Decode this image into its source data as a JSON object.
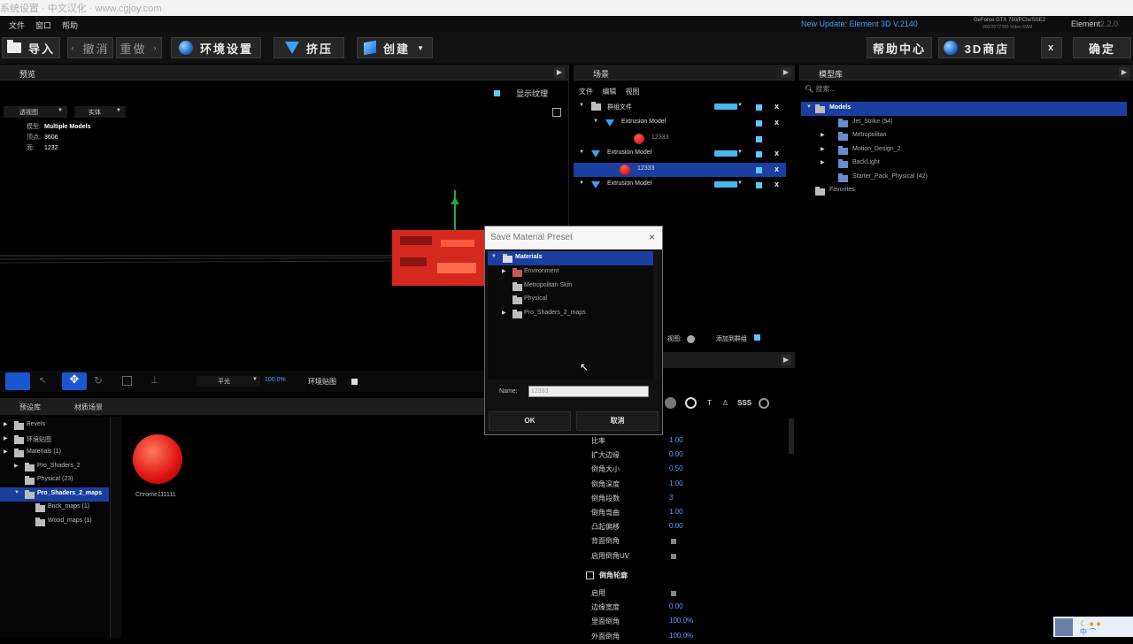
{
  "title_bar": {
    "text": "系统设置 · 中文汉化 · www.cgjoy.com"
  },
  "menu": {
    "items": [
      "文件",
      "窗口",
      "帮助"
    ],
    "update": "New Update: Element 3D V.2140",
    "gpu": "GeForce GTX 750/PCIe/SSE2",
    "gpu2": "900/3072 MB Video RAM",
    "app": "Element",
    "ver": "2.2.0"
  },
  "toolbar": {
    "import": "导入",
    "undo": "撤消",
    "redo": "重做",
    "env": "环境设置",
    "extrude": "挤压",
    "create": "创建",
    "help": "帮助中心",
    "store": "3D商店",
    "close": "x",
    "ok": "确定"
  },
  "viewport": {
    "title": "预览",
    "flat_texture": "显示纹理",
    "camera": "透视图",
    "mode": "实体",
    "info": [
      {
        "k": "模型:",
        "v": "Multiple Models"
      },
      {
        "k": "顶点:",
        "v": "3606"
      },
      {
        "k": "面:",
        "v": "1232"
      }
    ],
    "zoom_label": "平光",
    "zoom_value": "100.0%",
    "env_label": "环境贴图"
  },
  "scene": {
    "title": "场景",
    "menu": [
      "文件",
      "编辑",
      "视图"
    ],
    "rows": [
      {
        "label": "群组文件",
        "indent": 0,
        "x": true,
        "pill": true
      },
      {
        "label": "Extrusion Model",
        "indent": 1,
        "x": true
      },
      {
        "label": "12333",
        "indent": 2,
        "ball": true
      },
      {
        "label": "Extrusion Model",
        "indent": 0,
        "x": true,
        "pill": true
      },
      {
        "label": "12333",
        "indent": 1,
        "ball": true,
        "selected": true
      },
      {
        "label": "Extrusion Model",
        "indent": 0,
        "x": true,
        "pill": true
      }
    ],
    "view_label": "视图:",
    "add_label": "添加到群组"
  },
  "model_browser": {
    "title": "模型库",
    "search": "搜索...",
    "items": [
      {
        "label": "Models",
        "selected": true,
        "indent": 0
      },
      {
        "label": "Jet_Strike (54)",
        "indent": 1
      },
      {
        "label": "Metropolitan",
        "indent": 1,
        "arrow": true
      },
      {
        "label": "Motion_Design_2",
        "indent": 1,
        "arrow": true
      },
      {
        "label": "BackLight",
        "indent": 1,
        "arrow": true
      },
      {
        "label": "Starter_Pack_Physical (42)",
        "indent": 1
      },
      {
        "label": "Favorites",
        "indent": 0
      }
    ]
  },
  "materials": {
    "tabs": [
      "预设库",
      "材质场景"
    ],
    "tree": [
      {
        "label": "Bevels",
        "indent": 0,
        "arrow": true
      },
      {
        "label": "环境贴图",
        "indent": 0,
        "arrow": true
      },
      {
        "label": "Materials (1)",
        "indent": 0,
        "arrow": true
      },
      {
        "label": "Pro_Shaders_2",
        "indent": 1,
        "arrow": true
      },
      {
        "label": "Physical (23)",
        "indent": 1
      },
      {
        "label": "Pro_Shaders_2_maps",
        "indent": 1,
        "selected": true,
        "arrow": true
      },
      {
        "label": "Brick_maps (1)",
        "indent": 2
      },
      {
        "label": "Wood_maps (1)",
        "indent": 2
      }
    ],
    "thumb_label": "Chrome111111"
  },
  "dialog": {
    "title": "Save Material Preset",
    "root": "Materials",
    "items": [
      {
        "label": "Environment",
        "arrow": true,
        "red": true
      },
      {
        "label": "Metropolitan Skin"
      },
      {
        "label": "Physical"
      },
      {
        "label": "Pro_Shaders_2_maps",
        "arrow": true
      }
    ],
    "name_label": "Name:",
    "name_value": "12333",
    "ok": "OK",
    "cancel": "取消"
  },
  "properties": {
    "icons": [
      "SSS"
    ],
    "rows": [
      {
        "k": "比率",
        "v": "1.00"
      },
      {
        "k": "扩大边缘",
        "v": "0.00"
      },
      {
        "k": "倒角大小",
        "v": "0.50"
      },
      {
        "k": "倒角深度",
        "v": "1.00"
      },
      {
        "k": "倒角段数",
        "v": "3"
      },
      {
        "k": "倒角弯曲",
        "v": "1.00"
      },
      {
        "k": "凸起偏移",
        "v": "0.00"
      },
      {
        "k": "背面倒角",
        "v": ""
      },
      {
        "k": "启用倒角UV",
        "v": ""
      }
    ],
    "section": "倒角轮廓",
    "rows2": [
      {
        "k": "启用",
        "v": ""
      },
      {
        "k": "边缘宽度",
        "v": "0.00"
      },
      {
        "k": "里面倒角",
        "v": "100.0%"
      },
      {
        "k": "外面倒角",
        "v": "100.0%"
      }
    ]
  }
}
